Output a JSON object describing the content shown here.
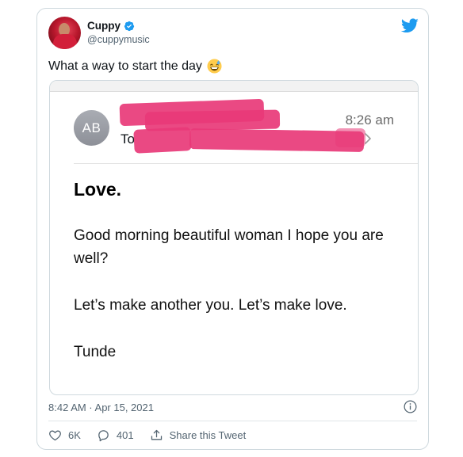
{
  "author": {
    "name": "Cuppy",
    "handle": "@cuppymusic",
    "verified": true,
    "avatar_icon": "profile-photo"
  },
  "tweet": {
    "text": "What a way to start the day",
    "emoji": "grinning-face-with-sweat"
  },
  "email": {
    "sender_initials": "AB",
    "time": "8:26 am",
    "to_label": "To",
    "subject": "Love.",
    "body": [
      "Good morning beautiful woman I hope you are well?",
      "Let’s make another you. Let’s make love.",
      "Tunde"
    ],
    "redaction_color": "#e83a78"
  },
  "meta": {
    "timestamp": "8:42 AM · Apr 15, 2021"
  },
  "actions": {
    "likes": "6K",
    "replies": "401",
    "share_label": "Share this Tweet"
  },
  "colors": {
    "twitter_blue": "#1d9bf0",
    "muted": "#536471"
  }
}
